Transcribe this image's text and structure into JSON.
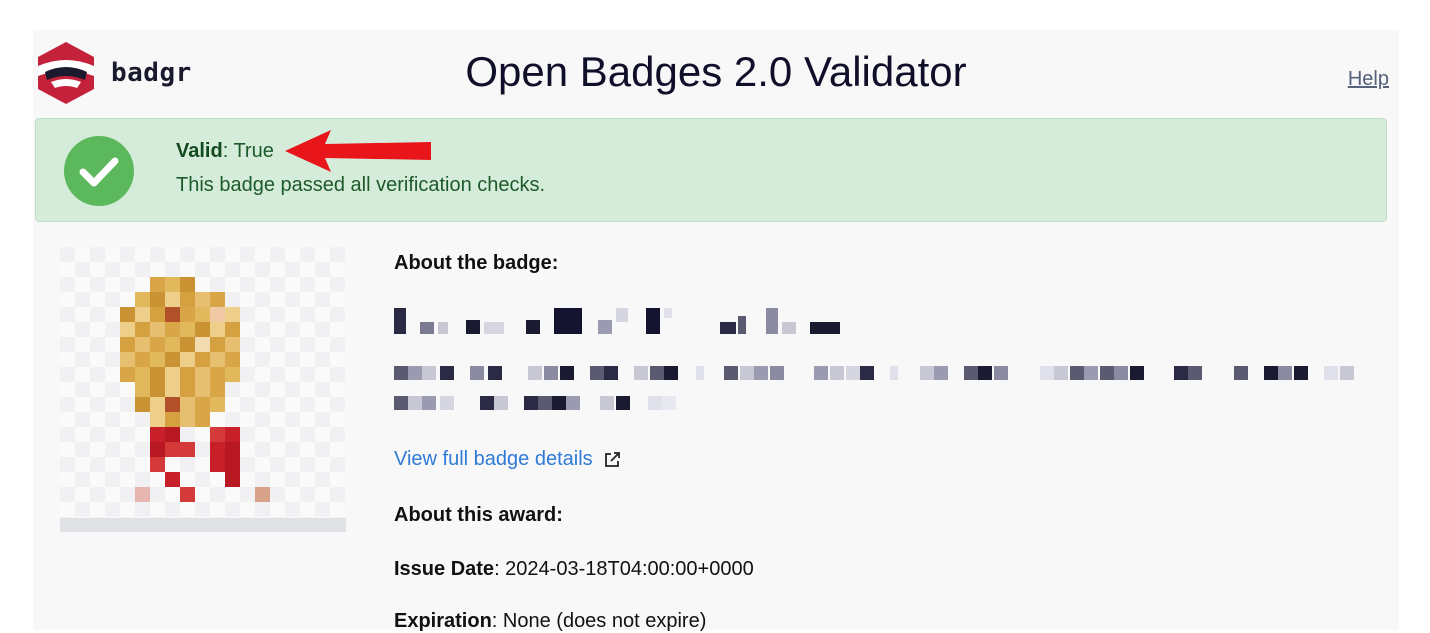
{
  "header": {
    "brand": "badgr",
    "title": "Open Badges 2.0 Validator",
    "help_label": "Help"
  },
  "alert": {
    "valid_label": "Valid",
    "valid_value": ": True",
    "message": "This badge passed all verification checks."
  },
  "badge": {
    "about_heading": "About the badge:",
    "details_link": "View full badge details",
    "award_heading": "About this award:",
    "issue_date_label": "Issue Date",
    "issue_date_value": ": 2024-03-18T04:00:00+0000",
    "expiration_label": "Expiration",
    "expiration_value": ": None (does not expire)"
  },
  "colors": {
    "valid_bg": "#d5ecda",
    "valid_text": "#1d5a2a",
    "check_green": "#5cb85c",
    "link": "#2f7ad6",
    "arrow": "#e8161b"
  },
  "icons": [
    "badgr-logo-icon",
    "checkmark-icon",
    "external-link-icon",
    "annotation-arrow-icon"
  ]
}
